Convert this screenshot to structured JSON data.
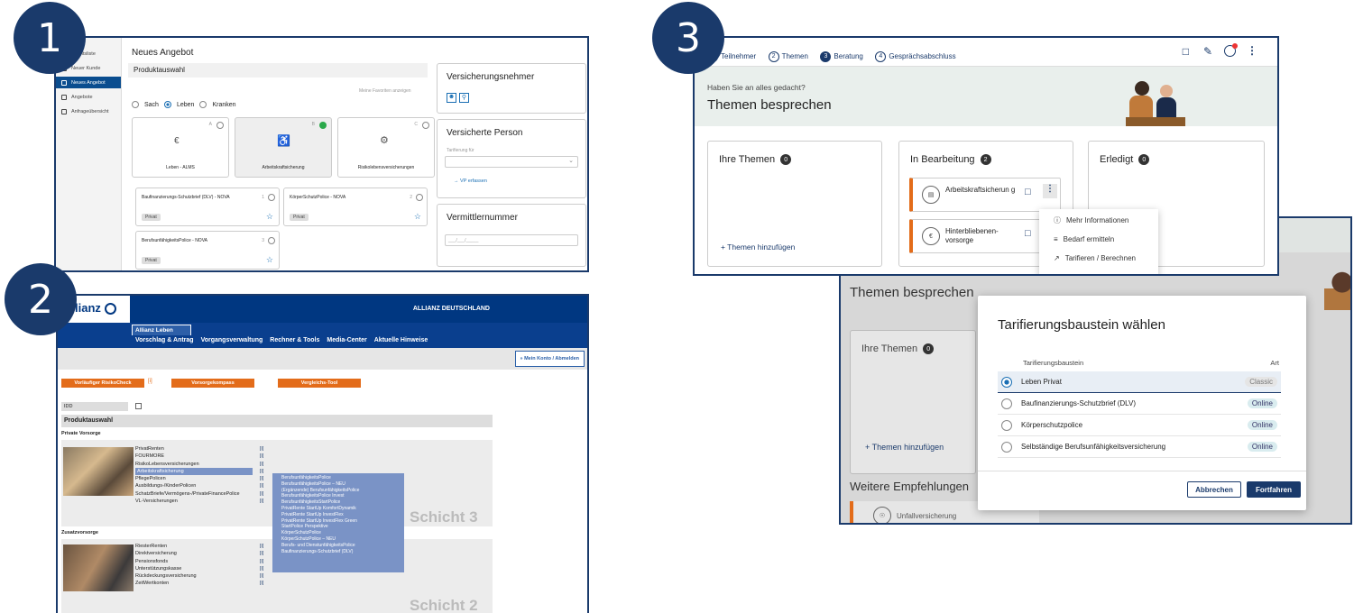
{
  "badges": [
    "1",
    "2",
    "3"
  ],
  "p1": {
    "sidebar": [
      "Arbeitsliste",
      "Neuer Kunde",
      "Neues Angebot",
      "Angebote",
      "Anfrageübersicht"
    ],
    "title": "Neues Angebot",
    "section": "Produktauswahl",
    "favorites": "Meine Favoriten anzeigen",
    "radios": [
      "Sach",
      "Leben",
      "Kranken"
    ],
    "cards": [
      {
        "letter": "A",
        "label": "Leben - ALMS"
      },
      {
        "letter": "B",
        "label": "Arbeitskraftsicherung"
      },
      {
        "letter": "C",
        "label": "Risikolebensversicherungen"
      }
    ],
    "products": [
      {
        "name": "Baufinanzierungs-Schutzbrief (DLV) - NOVA",
        "num": "1",
        "tag": "Privat"
      },
      {
        "name": "KörperSchutzPolice - NOVA",
        "num": "2",
        "tag": "Privat"
      },
      {
        "name": "BerufsunfähigkeitsPolice - NOVA",
        "num": "3",
        "tag": "Privat"
      }
    ],
    "vn_title": "Versicherungsnehmer",
    "vp_title": "Versicherte Person",
    "vp_field": "Tarifierung für",
    "vp_link": "→ VP erfassen",
    "vm_title": "Vermittlernummer",
    "vm_placeholder": "___/___/_____"
  },
  "p2": {
    "logo": "Allianz",
    "header": "ALLIANZ DEUTSCHLAND",
    "tab": "Allianz Leben",
    "nav": [
      "Vorschlag & Antrag",
      "Vorgangsverwaltung",
      "Rechner & Tools",
      "Media-Center",
      "Aktuelle Hinweise"
    ],
    "account": "» Mein Konto / Abmelden",
    "buttons": [
      "Vorläufiger RisikoCheck",
      "Vorsorgekompass",
      "Vergleichs-Tool"
    ],
    "idd": "IDD",
    "produktauswahl": "Produktauswahl",
    "private": "Private Vorsorge",
    "private_items": [
      "PrivatRenten",
      "FOURMORE",
      "RisikoLebensversicherungen",
      "Arbeitskraftsicherung",
      "PflegePolicen",
      "Ausbildungs-/KinderPolicen",
      "SchatzBriefe/Vermögens-/PrivateFinancePolice",
      "VL-Versicherungen"
    ],
    "schicht3": "Schicht 3",
    "zusatz": "Zusatzvorsorge",
    "zusatz_items": [
      "RiesterRenten",
      "Direktversicherung",
      "Pensionsfonds",
      "Unterstützungskasse",
      "Rückdeckungsversicherung",
      "ZeitWertkonten"
    ],
    "schicht2": "Schicht 2",
    "marker": "[i]",
    "dropdown": [
      "BerufsunfähigkeitsPolice",
      "BerufsunfähigkeitsPolice – NEU",
      "(Ergänzende) BerufsunfähigkeitsPolice",
      "BerufsunfähigkeitsPolice Invest",
      "BerufsunfähigkeitsStartPolice",
      "PrivatRente StartUp KomfortDynamik",
      "PrivatRente StartUp InvestFlex",
      "PrivatRente StartUp InvestFlex Green",
      "StartPolice Perspektive",
      "KörperSchutzPolice",
      "KörperSchutzPolice – NEU",
      "Berufs- und DienstunfähigkeitsPolice",
      "Baufinanzierungs-Schutzbrief (DLV)"
    ]
  },
  "p3": {
    "steps": [
      {
        "n": "1",
        "label": "Teilnehmer"
      },
      {
        "n": "2",
        "label": "Themen"
      },
      {
        "n": "3",
        "label": "Beratung"
      },
      {
        "n": "4",
        "label": "Gesprächsabschluss"
      }
    ],
    "question": "Haben Sie an alles gedacht?",
    "title": "Themen besprechen",
    "cols": [
      {
        "title": "Ihre Themen",
        "count": "0"
      },
      {
        "title": "In Bearbeitung",
        "count": "2"
      },
      {
        "title": "Erledigt",
        "count": "0"
      }
    ],
    "add": "+ Themen hinzufügen",
    "items": [
      "Arbeitskraftsicherun g",
      "Hinterbliebenen- vorsorge"
    ],
    "menu": [
      "Mehr Informationen",
      "Bedarf ermitteln",
      "Tarifieren / Berechnen"
    ]
  },
  "p4": {
    "title": "Themen besprechen",
    "col": "Ihre Themen",
    "count": "0",
    "add": "+ Themen hinzufügen",
    "weitere": "Weitere Empfehlungen",
    "unfall": "Unfallversicherung",
    "dialog": {
      "title": "Tarifierungsbaustein wählen",
      "col1": "Tarifierungsbaustein",
      "col2": "Art",
      "rows": [
        {
          "name": "Leben Privat",
          "art": "Classic"
        },
        {
          "name": "Baufinanzierungs-Schutzbrief (DLV)",
          "art": "Online"
        },
        {
          "name": "Körperschutzpolice",
          "art": "Online"
        },
        {
          "name": "Selbständige Berufsunfähigkeitsversicherung",
          "art": "Online"
        }
      ],
      "cancel": "Abbrechen",
      "ok": "Fortfahren"
    }
  }
}
